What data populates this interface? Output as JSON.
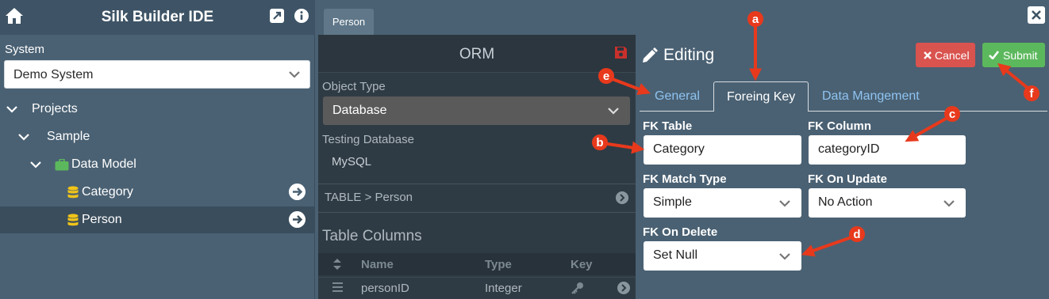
{
  "sidebar": {
    "title": "Silk Builder IDE",
    "system_label": "System",
    "system_value": "Demo System",
    "tree": [
      {
        "label": "Projects"
      },
      {
        "label": "Sample"
      },
      {
        "label": "Data Model"
      },
      {
        "label": "Category"
      },
      {
        "label": "Person"
      }
    ]
  },
  "topbar": {
    "tab_label": "Person"
  },
  "orm": {
    "title": "ORM",
    "object_type_label": "Object Type",
    "object_type_value": "Database",
    "testing_db_label": "Testing Database",
    "testing_db_value": "MySQL",
    "breadcrumb": "TABLE > Person",
    "table_columns_title": "Table Columns",
    "columns_header": [
      "Name",
      "Type",
      "Key"
    ],
    "row": {
      "name": "personID",
      "type": "Integer"
    }
  },
  "editing": {
    "title": "Editing",
    "cancel_label": "Cancel",
    "submit_label": "Submit",
    "tabs": [
      {
        "label": "General"
      },
      {
        "label": "Foreing Key"
      },
      {
        "label": "Data Mangement"
      }
    ],
    "fields": {
      "fk_table": {
        "label": "FK Table",
        "value": "Category"
      },
      "fk_column": {
        "label": "FK Column",
        "value": "categoryID"
      },
      "fk_match": {
        "label": "FK Match Type",
        "value": "Simple"
      },
      "fk_update": {
        "label": "FK On Update",
        "value": "No Action"
      },
      "fk_delete": {
        "label": "FK On Delete",
        "value": "Set Null"
      }
    }
  },
  "annotations": {
    "a": "a",
    "b": "b",
    "c": "c",
    "d": "d",
    "e": "e",
    "f": "f"
  },
  "colors": {
    "accent_red": "#d9534f",
    "accent_green": "#5cb85c",
    "tab_link": "#8fc3f0",
    "annotation": "#e8391c"
  }
}
